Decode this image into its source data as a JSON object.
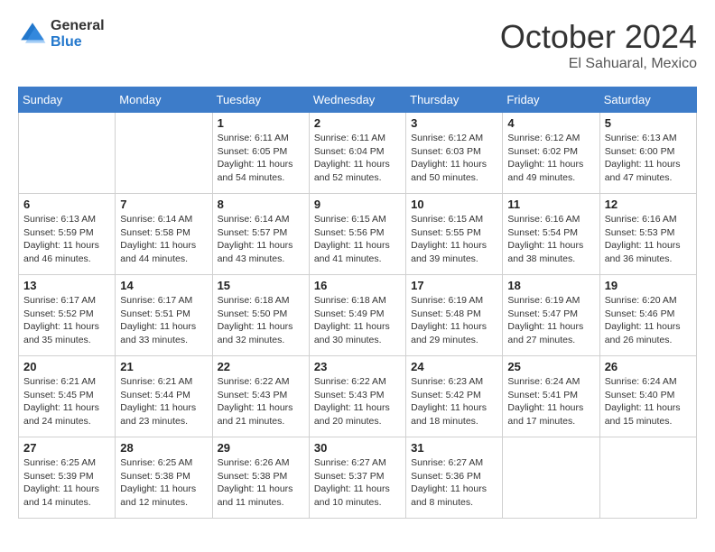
{
  "header": {
    "logo": {
      "general": "General",
      "blue": "Blue"
    },
    "title": "October 2024",
    "location": "El Sahuaral, Mexico"
  },
  "days_of_week": [
    "Sunday",
    "Monday",
    "Tuesday",
    "Wednesday",
    "Thursday",
    "Friday",
    "Saturday"
  ],
  "weeks": [
    [
      {
        "day": "",
        "info": ""
      },
      {
        "day": "",
        "info": ""
      },
      {
        "day": "1",
        "info": "Sunrise: 6:11 AM\nSunset: 6:05 PM\nDaylight: 11 hours and 54 minutes."
      },
      {
        "day": "2",
        "info": "Sunrise: 6:11 AM\nSunset: 6:04 PM\nDaylight: 11 hours and 52 minutes."
      },
      {
        "day": "3",
        "info": "Sunrise: 6:12 AM\nSunset: 6:03 PM\nDaylight: 11 hours and 50 minutes."
      },
      {
        "day": "4",
        "info": "Sunrise: 6:12 AM\nSunset: 6:02 PM\nDaylight: 11 hours and 49 minutes."
      },
      {
        "day": "5",
        "info": "Sunrise: 6:13 AM\nSunset: 6:00 PM\nDaylight: 11 hours and 47 minutes."
      }
    ],
    [
      {
        "day": "6",
        "info": "Sunrise: 6:13 AM\nSunset: 5:59 PM\nDaylight: 11 hours and 46 minutes."
      },
      {
        "day": "7",
        "info": "Sunrise: 6:14 AM\nSunset: 5:58 PM\nDaylight: 11 hours and 44 minutes."
      },
      {
        "day": "8",
        "info": "Sunrise: 6:14 AM\nSunset: 5:57 PM\nDaylight: 11 hours and 43 minutes."
      },
      {
        "day": "9",
        "info": "Sunrise: 6:15 AM\nSunset: 5:56 PM\nDaylight: 11 hours and 41 minutes."
      },
      {
        "day": "10",
        "info": "Sunrise: 6:15 AM\nSunset: 5:55 PM\nDaylight: 11 hours and 39 minutes."
      },
      {
        "day": "11",
        "info": "Sunrise: 6:16 AM\nSunset: 5:54 PM\nDaylight: 11 hours and 38 minutes."
      },
      {
        "day": "12",
        "info": "Sunrise: 6:16 AM\nSunset: 5:53 PM\nDaylight: 11 hours and 36 minutes."
      }
    ],
    [
      {
        "day": "13",
        "info": "Sunrise: 6:17 AM\nSunset: 5:52 PM\nDaylight: 11 hours and 35 minutes."
      },
      {
        "day": "14",
        "info": "Sunrise: 6:17 AM\nSunset: 5:51 PM\nDaylight: 11 hours and 33 minutes."
      },
      {
        "day": "15",
        "info": "Sunrise: 6:18 AM\nSunset: 5:50 PM\nDaylight: 11 hours and 32 minutes."
      },
      {
        "day": "16",
        "info": "Sunrise: 6:18 AM\nSunset: 5:49 PM\nDaylight: 11 hours and 30 minutes."
      },
      {
        "day": "17",
        "info": "Sunrise: 6:19 AM\nSunset: 5:48 PM\nDaylight: 11 hours and 29 minutes."
      },
      {
        "day": "18",
        "info": "Sunrise: 6:19 AM\nSunset: 5:47 PM\nDaylight: 11 hours and 27 minutes."
      },
      {
        "day": "19",
        "info": "Sunrise: 6:20 AM\nSunset: 5:46 PM\nDaylight: 11 hours and 26 minutes."
      }
    ],
    [
      {
        "day": "20",
        "info": "Sunrise: 6:21 AM\nSunset: 5:45 PM\nDaylight: 11 hours and 24 minutes."
      },
      {
        "day": "21",
        "info": "Sunrise: 6:21 AM\nSunset: 5:44 PM\nDaylight: 11 hours and 23 minutes."
      },
      {
        "day": "22",
        "info": "Sunrise: 6:22 AM\nSunset: 5:43 PM\nDaylight: 11 hours and 21 minutes."
      },
      {
        "day": "23",
        "info": "Sunrise: 6:22 AM\nSunset: 5:43 PM\nDaylight: 11 hours and 20 minutes."
      },
      {
        "day": "24",
        "info": "Sunrise: 6:23 AM\nSunset: 5:42 PM\nDaylight: 11 hours and 18 minutes."
      },
      {
        "day": "25",
        "info": "Sunrise: 6:24 AM\nSunset: 5:41 PM\nDaylight: 11 hours and 17 minutes."
      },
      {
        "day": "26",
        "info": "Sunrise: 6:24 AM\nSunset: 5:40 PM\nDaylight: 11 hours and 15 minutes."
      }
    ],
    [
      {
        "day": "27",
        "info": "Sunrise: 6:25 AM\nSunset: 5:39 PM\nDaylight: 11 hours and 14 minutes."
      },
      {
        "day": "28",
        "info": "Sunrise: 6:25 AM\nSunset: 5:38 PM\nDaylight: 11 hours and 12 minutes."
      },
      {
        "day": "29",
        "info": "Sunrise: 6:26 AM\nSunset: 5:38 PM\nDaylight: 11 hours and 11 minutes."
      },
      {
        "day": "30",
        "info": "Sunrise: 6:27 AM\nSunset: 5:37 PM\nDaylight: 11 hours and 10 minutes."
      },
      {
        "day": "31",
        "info": "Sunrise: 6:27 AM\nSunset: 5:36 PM\nDaylight: 11 hours and 8 minutes."
      },
      {
        "day": "",
        "info": ""
      },
      {
        "day": "",
        "info": ""
      }
    ]
  ]
}
